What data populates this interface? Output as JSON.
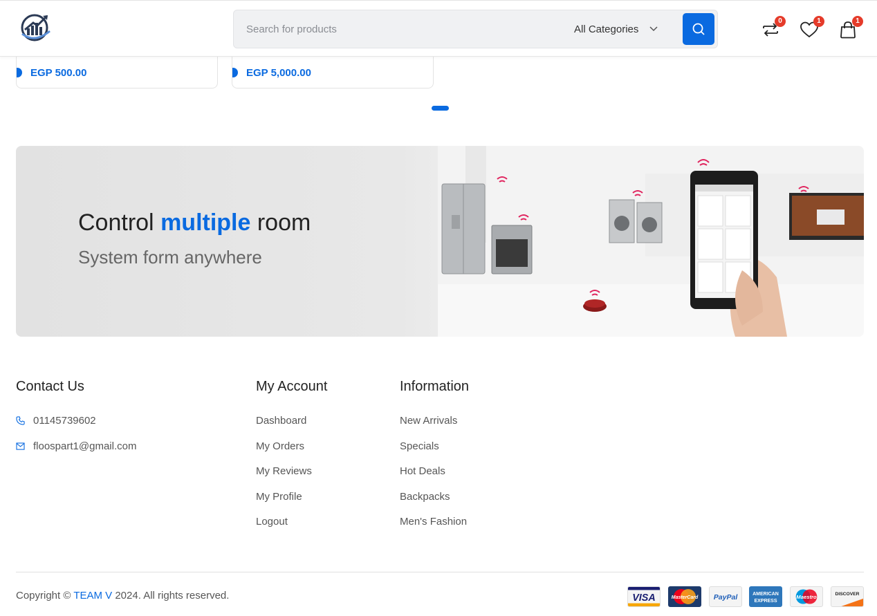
{
  "header": {
    "search_placeholder": "Search for products",
    "category_selected": "All Categories",
    "compare_count": "0",
    "wishlist_count": "1",
    "cart_count": "1",
    "accent_color": "#0a6ae0",
    "badge_color": "#e53b2a"
  },
  "products": [
    {
      "price": "EGP 500.00"
    },
    {
      "price": "EGP 5,000.00"
    }
  ],
  "banner": {
    "title_before": "Control ",
    "title_highlight": "multiple",
    "title_after": " room",
    "subtitle": "System form anywhere"
  },
  "footer": {
    "contact": {
      "title": "Contact Us",
      "phone": "01145739602",
      "email": "floospart1@gmail.com"
    },
    "account": {
      "title": "My Account",
      "links": [
        "Dashboard",
        "My Orders",
        "My Reviews",
        "My Profile",
        "Logout"
      ]
    },
    "information": {
      "title": "Information",
      "links": [
        "New Arrivals",
        "Specials",
        "Hot Deals",
        "Backpacks",
        "Men's Fashion"
      ]
    },
    "copyright_prefix": "Copyright © ",
    "copyright_team": "TEAM V",
    "copyright_suffix": " 2024. All rights reserved.",
    "payment_methods": [
      "VISA",
      "MasterCard",
      "PayPal",
      "AMERICAN EXPRESS",
      "Maestro",
      "DISCOVER"
    ]
  }
}
